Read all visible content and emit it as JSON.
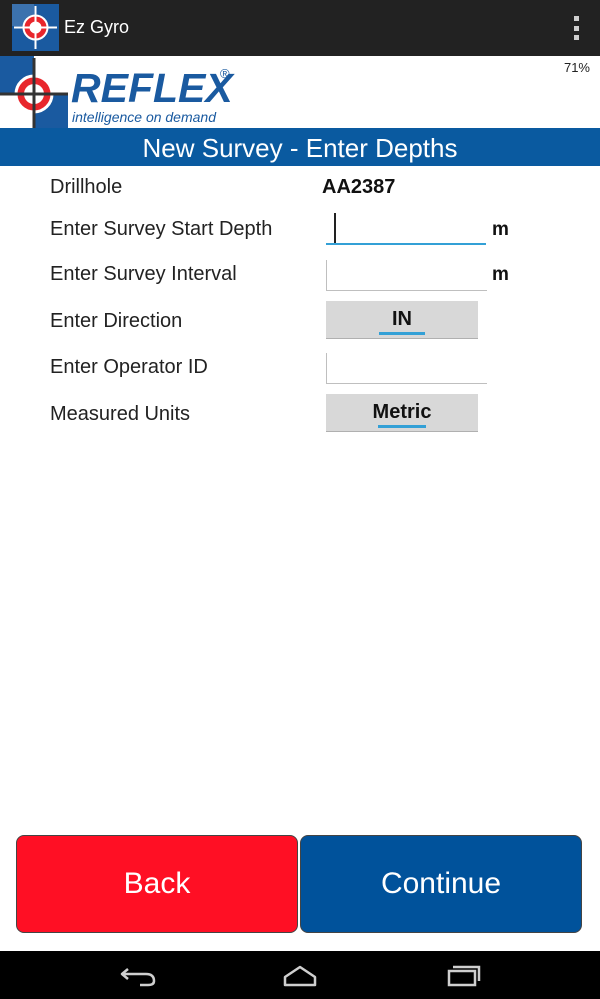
{
  "app_bar": {
    "title": "Ez Gyro",
    "icon": "crosshair-logo-icon",
    "menu_icon": "overflow-menu-icon"
  },
  "status": {
    "battery": "71%"
  },
  "logo": {
    "wordmark": "REFLEX",
    "registered": "®",
    "tagline": "intelligence on demand"
  },
  "header": {
    "title": "New Survey - Enter Depths"
  },
  "form": {
    "drillhole_label": "Drillhole",
    "drillhole_value": "AA2387",
    "start_depth_label": "Enter Survey Start Depth",
    "start_depth_value": "",
    "start_depth_unit": "m",
    "interval_label": "Enter Survey Interval",
    "interval_value": "",
    "interval_unit": "m",
    "direction_label": "Enter Direction",
    "direction_value": "IN",
    "operator_label": "Enter Operator ID",
    "operator_value": "",
    "units_label": "Measured Units",
    "units_value": "Metric"
  },
  "buttons": {
    "back": "Back",
    "continue": "Continue"
  },
  "nav": {
    "back_icon": "nav-back-icon",
    "home_icon": "nav-home-icon",
    "recents_icon": "nav-recents-icon"
  },
  "colors": {
    "brand_blue": "#0a5aa0",
    "back_red": "#ff0f24",
    "continue_blue": "#00529b",
    "focus_accent": "#33a0d6"
  }
}
